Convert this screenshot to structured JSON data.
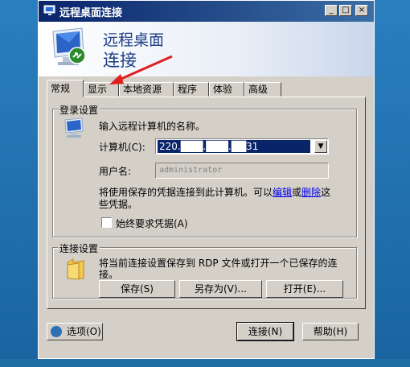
{
  "window": {
    "title": "远程桌面连接"
  },
  "titlebar": {
    "minimize": "_",
    "maximize": "□",
    "close": "×"
  },
  "banner": {
    "line1": "远程桌面",
    "line2": "连接"
  },
  "tabs": [
    "常规",
    "显示",
    "本地资源",
    "程序",
    "体验",
    "高级"
  ],
  "login_group": {
    "legend": "登录设置",
    "instruction": "输入远程计算机的名称。",
    "computer_label": "计算机(C):",
    "computer_value": "220.███.███.██31",
    "username_label": "用户名:",
    "username_value": "administrator",
    "note_line1_prefix": "将使用保存的凭据连接到此计算机。可以",
    "note_link_edit": "编辑",
    "note_or": "或",
    "note_link_delete": "删除",
    "note_line1_suffix": "这",
    "note_line2": "些凭据。",
    "checkbox_label": "始终要求凭据(A)"
  },
  "connection_group": {
    "legend": "连接设置",
    "description_line1": "将当前连接设置保存到 RDP 文件或打开一个已保存的连",
    "description_line2": "接。",
    "save_button": "保存(S)",
    "save_as_button": "另存为(V)...",
    "open_button": "打开(E)..."
  },
  "footer": {
    "options_button": "选项(O)",
    "connect_button": "连接(N)",
    "help_button": "帮助(H)"
  },
  "colors": {
    "titlebar_start": "#0a246a",
    "titlebar_end": "#3a6ea5",
    "desktop": "#1f6ea6",
    "annotation_arrow": "#e02020"
  }
}
